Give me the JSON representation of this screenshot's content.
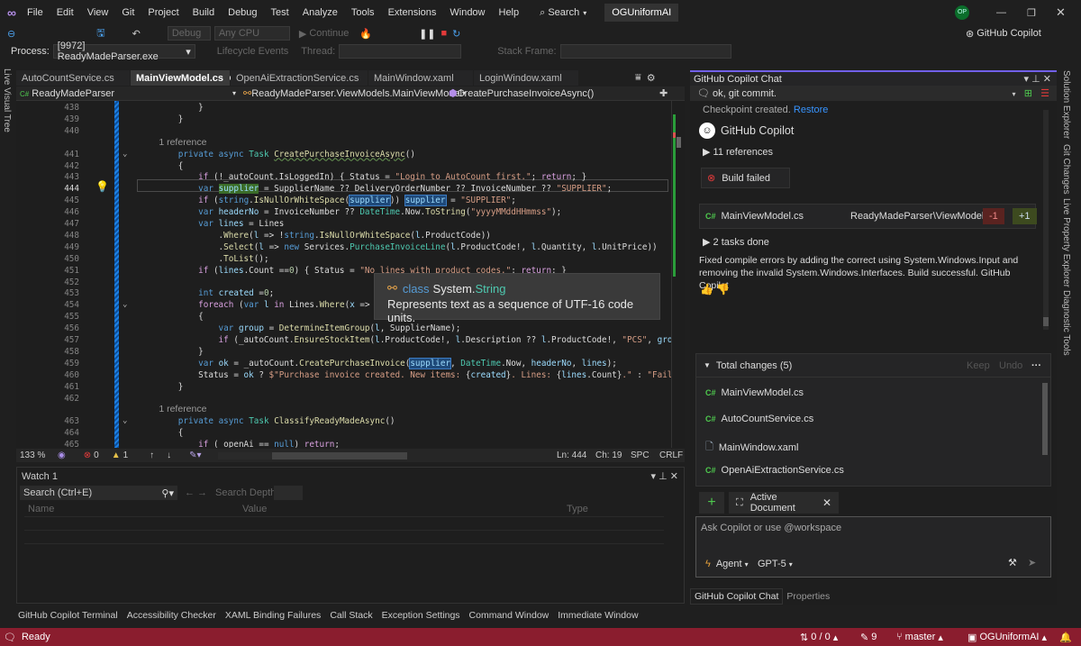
{
  "menu": {
    "items": [
      "File",
      "Edit",
      "View",
      "Git",
      "Project",
      "Build",
      "Debug",
      "Test",
      "Analyze",
      "Tools",
      "Extensions",
      "Window",
      "Help"
    ],
    "search": "Search",
    "solution": "OGUniformAI",
    "avatar": "OP"
  },
  "toolbar": {
    "config": "Debug",
    "platform": "Any CPU",
    "continue": "Continue",
    "copilot": "GitHub Copilot",
    "process_label": "Process:",
    "process": "[9972] ReadyMadeParser.exe",
    "lifecycle": "Lifecycle Events",
    "thread": "Thread:",
    "stack_frame": "Stack Frame:"
  },
  "left_strip": "Live Visual Tree",
  "editor": {
    "tabs": [
      "AutoCountService.cs",
      "MainViewModel.cs",
      "OpenAiExtractionService.cs",
      "MainWindow.xaml",
      "LoginWindow.xaml"
    ],
    "nav": {
      "project": "ReadyMadeParser",
      "class": "ReadyMadeParser.ViewModels.MainViewModel",
      "member": "CreatePurchaseInvoiceAsync()"
    },
    "status": {
      "zoom": "133 %",
      "errors": "0",
      "warnings": "1",
      "ln": "Ln: 444",
      "ch": "Ch: 19",
      "spc": "SPC",
      "crlf": "CRLF"
    },
    "tooltip": {
      "kind": "class",
      "ns": "System.",
      "name": "String",
      "desc": "Represents text as a sequence of UTF-16 code units."
    }
  },
  "code": {
    "lines": [
      {
        "n": "438",
        "t": [
          [
            "p",
            "            }"
          ]
        ]
      },
      {
        "n": "439",
        "t": [
          [
            "p",
            "        }"
          ]
        ]
      },
      {
        "n": "440",
        "t": []
      },
      {
        "n": "",
        "ref": true,
        "t": [
          [
            "ref",
            "        1 reference"
          ]
        ]
      },
      {
        "n": "441",
        "f": 1,
        "t": [
          [
            "k",
            "        private"
          ],
          [
            "p",
            " "
          ],
          [
            "k",
            "async"
          ],
          [
            "p",
            " "
          ],
          [
            "t",
            "Task"
          ],
          [
            "p",
            " "
          ],
          [
            "m sq",
            "CreatePurchaseInvoiceAsync"
          ],
          [
            "p",
            "()"
          ]
        ]
      },
      {
        "n": "442",
        "t": [
          [
            "p",
            "        {"
          ]
        ]
      },
      {
        "n": "443",
        "t": [
          [
            "c",
            "            if"
          ],
          [
            "p",
            " (!_autoCount.IsLoggedIn) { Status = "
          ],
          [
            "s",
            "\"Login to AutoCount first.\""
          ],
          [
            "p",
            "; "
          ],
          [
            "c",
            "return"
          ],
          [
            "p",
            "; }"
          ]
        ]
      },
      {
        "n": "444",
        "cur": true,
        "t": [
          [
            "k",
            "            var"
          ],
          [
            "p",
            " "
          ],
          [
            "hd",
            "supplier"
          ],
          [
            "p",
            " = SupplierName ?? DeliveryOrderNumber ?? InvoiceNumber ?? "
          ],
          [
            "s",
            "\"SUPPLIER\""
          ],
          [
            "p",
            ";"
          ]
        ]
      },
      {
        "n": "445",
        "t": [
          [
            "c",
            "            if"
          ],
          [
            "p",
            " ("
          ],
          [
            "k",
            "string"
          ],
          [
            "p",
            "."
          ],
          [
            "m",
            "IsNullOrWhiteSpace"
          ],
          [
            "p",
            "("
          ],
          [
            "hr",
            "supplier"
          ],
          [
            "p",
            ")) "
          ],
          [
            "hr",
            "supplier"
          ],
          [
            "p",
            " = "
          ],
          [
            "s",
            "\"SUPPLIER\""
          ],
          [
            "p",
            ";"
          ]
        ]
      },
      {
        "n": "446",
        "t": [
          [
            "k",
            "            var"
          ],
          [
            "p",
            " "
          ],
          [
            "v",
            "headerNo"
          ],
          [
            "p",
            " = InvoiceNumber ?? "
          ],
          [
            "t",
            "DateTime"
          ],
          [
            "p",
            ".Now."
          ],
          [
            "m",
            "ToString"
          ],
          [
            "p",
            "("
          ],
          [
            "s",
            "\"yyyyMMddHHmmss\""
          ],
          [
            "p",
            ");"
          ]
        ]
      },
      {
        "n": "447",
        "t": [
          [
            "k",
            "            var"
          ],
          [
            "p",
            " "
          ],
          [
            "v",
            "lines"
          ],
          [
            "p",
            " = Lines"
          ]
        ]
      },
      {
        "n": "448",
        "t": [
          [
            "p",
            "                ."
          ],
          [
            "m",
            "Where"
          ],
          [
            "p",
            "("
          ],
          [
            "v",
            "l"
          ],
          [
            "p",
            " => !"
          ],
          [
            "k",
            "string"
          ],
          [
            "p",
            "."
          ],
          [
            "m",
            "IsNullOrWhiteSpace"
          ],
          [
            "p",
            "("
          ],
          [
            "v",
            "l"
          ],
          [
            "p",
            ".ProductCode))"
          ]
        ]
      },
      {
        "n": "449",
        "t": [
          [
            "p",
            "                ."
          ],
          [
            "m",
            "Select"
          ],
          [
            "p",
            "("
          ],
          [
            "v",
            "l"
          ],
          [
            "p",
            " => "
          ],
          [
            "k",
            "new"
          ],
          [
            "p",
            " Services."
          ],
          [
            "t",
            "PurchaseInvoiceLine"
          ],
          [
            "p",
            "("
          ],
          [
            "v",
            "l"
          ],
          [
            "p",
            ".ProductCode!, "
          ],
          [
            "v",
            "l"
          ],
          [
            "p",
            ".Quantity, "
          ],
          [
            "v",
            "l"
          ],
          [
            "p",
            ".UnitPrice))"
          ]
        ]
      },
      {
        "n": "450",
        "t": [
          [
            "p",
            "                ."
          ],
          [
            "m",
            "ToList"
          ],
          [
            "p",
            "();"
          ]
        ]
      },
      {
        "n": "451",
        "t": [
          [
            "c",
            "            if"
          ],
          [
            "p",
            " ("
          ],
          [
            "v",
            "lines"
          ],
          [
            "p",
            ".Count =="
          ],
          [
            "n",
            "0"
          ],
          [
            "p",
            ") { Status = "
          ],
          [
            "s",
            "\"No lines with product codes.\""
          ],
          [
            "p",
            "; "
          ],
          [
            "c",
            "return"
          ],
          [
            "p",
            "; }"
          ]
        ]
      },
      {
        "n": "452",
        "t": []
      },
      {
        "n": "453",
        "t": [
          [
            "k",
            "            int"
          ],
          [
            "p",
            " "
          ],
          [
            "v",
            "created"
          ],
          [
            "p",
            " ="
          ],
          [
            "n",
            "0"
          ],
          [
            "p",
            ";"
          ]
        ]
      },
      {
        "n": "454",
        "f": 1,
        "t": [
          [
            "c",
            "            foreach"
          ],
          [
            "p",
            " ("
          ],
          [
            "k",
            "var"
          ],
          [
            "p",
            " "
          ],
          [
            "v",
            "l"
          ],
          [
            "p",
            " "
          ],
          [
            "c",
            "in"
          ],
          [
            "p",
            " Lines."
          ],
          [
            "m",
            "Where"
          ],
          [
            "p",
            "("
          ],
          [
            "v",
            "x"
          ],
          [
            "p",
            " =>"
          ]
        ]
      },
      {
        "n": "455",
        "t": [
          [
            "p",
            "            {"
          ]
        ]
      },
      {
        "n": "456",
        "t": [
          [
            "k",
            "                var"
          ],
          [
            "p",
            " "
          ],
          [
            "v",
            "group"
          ],
          [
            "p",
            " = "
          ],
          [
            "m",
            "DetermineItemGroup"
          ],
          [
            "p",
            "("
          ],
          [
            "v",
            "l"
          ],
          [
            "p",
            ", SupplierName);"
          ]
        ]
      },
      {
        "n": "457",
        "t": [
          [
            "c",
            "                if"
          ],
          [
            "p",
            " (_autoCount."
          ],
          [
            "m",
            "EnsureStockItem"
          ],
          [
            "p",
            "("
          ],
          [
            "v",
            "l"
          ],
          [
            "p",
            ".ProductCode!, "
          ],
          [
            "v",
            "l"
          ],
          [
            "p",
            ".Description ?? "
          ],
          [
            "v",
            "l"
          ],
          [
            "p",
            ".ProductCode!, "
          ],
          [
            "s",
            "\"PCS\""
          ],
          [
            "p",
            ", "
          ],
          [
            "v",
            "gro"
          ]
        ]
      },
      {
        "n": "458",
        "t": [
          [
            "p",
            "            }"
          ]
        ]
      },
      {
        "n": "459",
        "t": [
          [
            "k",
            "            var"
          ],
          [
            "p",
            " "
          ],
          [
            "v",
            "ok"
          ],
          [
            "p",
            " = _autoCount."
          ],
          [
            "m",
            "CreatePurchaseInvoice"
          ],
          [
            "p",
            "("
          ],
          [
            "hr",
            "supplier"
          ],
          [
            "p",
            ", "
          ],
          [
            "t",
            "DateTime"
          ],
          [
            "p",
            ".Now, "
          ],
          [
            "v",
            "headerNo"
          ],
          [
            "p",
            ", "
          ],
          [
            "v",
            "lines"
          ],
          [
            "p",
            ");"
          ]
        ]
      },
      {
        "n": "460",
        "t": [
          [
            "p",
            "            Status = "
          ],
          [
            "v",
            "ok"
          ],
          [
            "p",
            " ? "
          ],
          [
            "s",
            "$\"Purchase invoice created. New items: "
          ],
          [
            "p",
            "{"
          ],
          [
            "v",
            "created"
          ],
          [
            "p",
            "}"
          ],
          [
            "s",
            ". Lines: "
          ],
          [
            "p",
            "{"
          ],
          [
            "v",
            "lines"
          ],
          [
            "p",
            ".Count}"
          ],
          [
            "s",
            ".\""
          ],
          [
            "p",
            " : "
          ],
          [
            "s",
            "\"Fail"
          ]
        ]
      },
      {
        "n": "461",
        "t": [
          [
            "p",
            "        }"
          ]
        ]
      },
      {
        "n": "462",
        "t": []
      },
      {
        "n": "",
        "ref": true,
        "t": [
          [
            "ref",
            "        1 reference"
          ]
        ]
      },
      {
        "n": "463",
        "f": 1,
        "t": [
          [
            "k",
            "        private"
          ],
          [
            "p",
            " "
          ],
          [
            "k",
            "async"
          ],
          [
            "p",
            " "
          ],
          [
            "t",
            "Task"
          ],
          [
            "p",
            " "
          ],
          [
            "m",
            "ClassifyReadyMadeAsync"
          ],
          [
            "p",
            "()"
          ]
        ]
      },
      {
        "n": "464",
        "t": [
          [
            "p",
            "        {"
          ]
        ]
      },
      {
        "n": "465",
        "t": [
          [
            "c",
            "            if"
          ],
          [
            "p",
            " (_openAi == "
          ],
          [
            "k",
            "null"
          ],
          [
            "p",
            ") "
          ],
          [
            "c",
            "return"
          ],
          [
            "p",
            ";"
          ]
        ]
      }
    ]
  },
  "watch": {
    "title": "Watch 1",
    "search": "Search (Ctrl+E)",
    "depth": "Search Depth:",
    "cols": [
      "Name",
      "Value",
      "Type"
    ]
  },
  "bottom_tabs": [
    "GitHub Copilot Terminal",
    "Accessibility Checker",
    "XAML Binding Failures",
    "Call Stack",
    "Exception Settings",
    "Command Window",
    "Immediate Window"
  ],
  "chat": {
    "title": "GitHub Copilot Chat",
    "thread": "ok, git commit.",
    "checkpoint": "Checkpoint created.",
    "restore": "Restore",
    "author": "GitHub Copilot",
    "references": "11 references",
    "build": "Build failed",
    "file": {
      "name": "MainViewModel.cs",
      "path": "ReadyMadeParser\\ViewModels",
      "removed": "-1",
      "added": "+1"
    },
    "tasks": "2 tasks done",
    "message": "Fixed compile errors by adding the correct using System.Windows.Input and removing the invalid System.Windows.Interfaces. Build successful. GitHub Copilot",
    "changes": {
      "title": "Total changes (5)",
      "keep": "Keep",
      "undo": "Undo",
      "files": [
        "MainViewModel.cs",
        "AutoCountService.cs",
        "MainWindow.xaml",
        "OpenAiExtractionService.cs"
      ]
    },
    "context": "Active Document",
    "placeholder": "Ask Copilot or use @workspace",
    "mode": "Agent",
    "model": "GPT-5",
    "tabs": [
      "GitHub Copilot Chat",
      "Properties"
    ]
  },
  "right_strip": [
    "Solution Explorer",
    "Git Changes",
    "Live Property Explorer",
    "Diagnostic Tools"
  ],
  "statusbar": {
    "ready": "Ready",
    "sync": "0 / 0",
    "edits": "9",
    "branch": "master",
    "repo": "OGUniformAI"
  },
  "colors": {
    "status": "#8a1d2e",
    "accent": "#7160e8"
  }
}
